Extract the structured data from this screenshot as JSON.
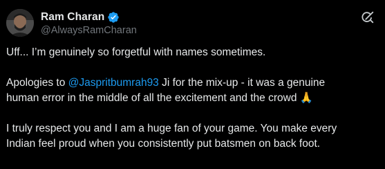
{
  "user": {
    "display_name": "Ram Charan",
    "handle": "@AlwaysRamCharan",
    "verified": true
  },
  "icons": {
    "verified": "verified-badge-icon",
    "grok": "grok-icon",
    "emoji": "folded-hands-icon"
  },
  "colors": {
    "background": "#000000",
    "text": "#e7e9ea",
    "secondary_text": "#71767b",
    "link": "#1d9bf0",
    "verified_badge": "#1d9bf0"
  },
  "tweet": {
    "line1": "Uff... I’m genuinely so forgetful with names sometimes.",
    "line2_prefix": "Apologies to ",
    "line2_mention": "@Jaspritbumrah93",
    "line2_suffix": " Ji for the mix-up - it was a genuine",
    "line3": "human error in the middle of all the excitement and the crowd ",
    "line3_emoji": "🙏",
    "line4": "I truly respect you and I am a huge fan of your game. You make every",
    "line5": "Indian feel proud when you consistently put batsmen on back foot."
  }
}
